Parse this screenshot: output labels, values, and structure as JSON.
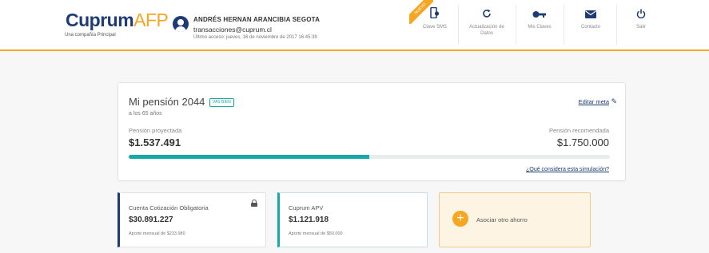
{
  "brand": {
    "logo_main": "Cuprum",
    "logo_afp": "AFP",
    "logo_sub": "Una compañía Principal"
  },
  "user": {
    "name": "ANDRÉS HERNAN ARANCIBIA SEGOTA",
    "email": "transacciones@cuprum.cl",
    "last_access": "Último acceso: jueves, 16 de noviembre de 2017 16:45:39"
  },
  "ribbon_label": "NUEVO",
  "nav": [
    {
      "label": "Clave SMS",
      "icon": "phone-key-icon"
    },
    {
      "label": "Actualización de Datos",
      "icon": "refresh-icon"
    },
    {
      "label": "Mis Claves",
      "icon": "key-icon"
    },
    {
      "label": "Contacto",
      "icon": "mail-icon"
    },
    {
      "label": "Salir",
      "icon": "power-icon"
    }
  ],
  "pension": {
    "title": "Mi pensión 2044",
    "badge": "VAS BIEN",
    "age": "a los 65 años",
    "edit_link": "Editar meta",
    "projected_label": "Pensión proyectada",
    "projected_value": "$1.537.491",
    "recommended_label": "Pensión recomendada",
    "recommended_value": "$1.750.000",
    "progress_percent": 50,
    "simulation_link": "¿Qué considera esta simulación?"
  },
  "accounts": [
    {
      "name": "Cuenta Cotización Obligatoria",
      "amount": "$30.891.227",
      "note": "Aporte mensual de $233.980"
    },
    {
      "name": "Cuprum APV",
      "amount": "$1.121.918",
      "note": "Aporte mensual de $50.000"
    }
  ],
  "add_account": {
    "label": "Asociar otro ahorro"
  },
  "colors": {
    "primary": "#1f3b73",
    "accent": "#f5a623",
    "teal": "#17a9a5"
  }
}
